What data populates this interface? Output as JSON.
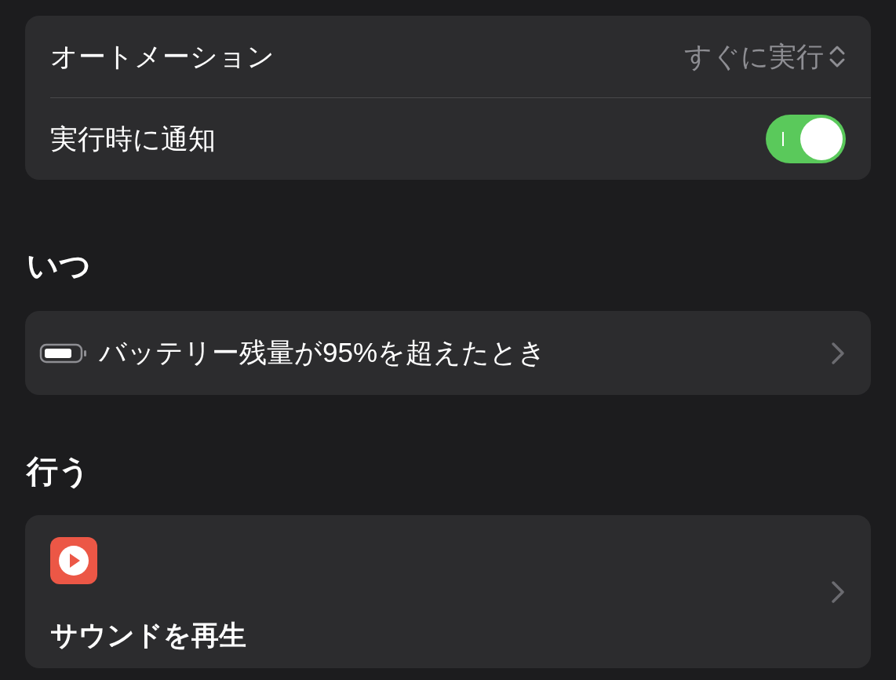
{
  "settings": [
    {
      "kind": "popup",
      "label": "オートメーション",
      "value": "すぐに実行"
    },
    {
      "kind": "toggle",
      "label": "実行時に通知",
      "on": true
    }
  ],
  "when": {
    "heading": "いつ",
    "trigger": {
      "label": "バッテリー残量が95%を超えたとき"
    }
  },
  "do": {
    "heading": "行う",
    "action": {
      "label": "サウンドを再生"
    }
  }
}
